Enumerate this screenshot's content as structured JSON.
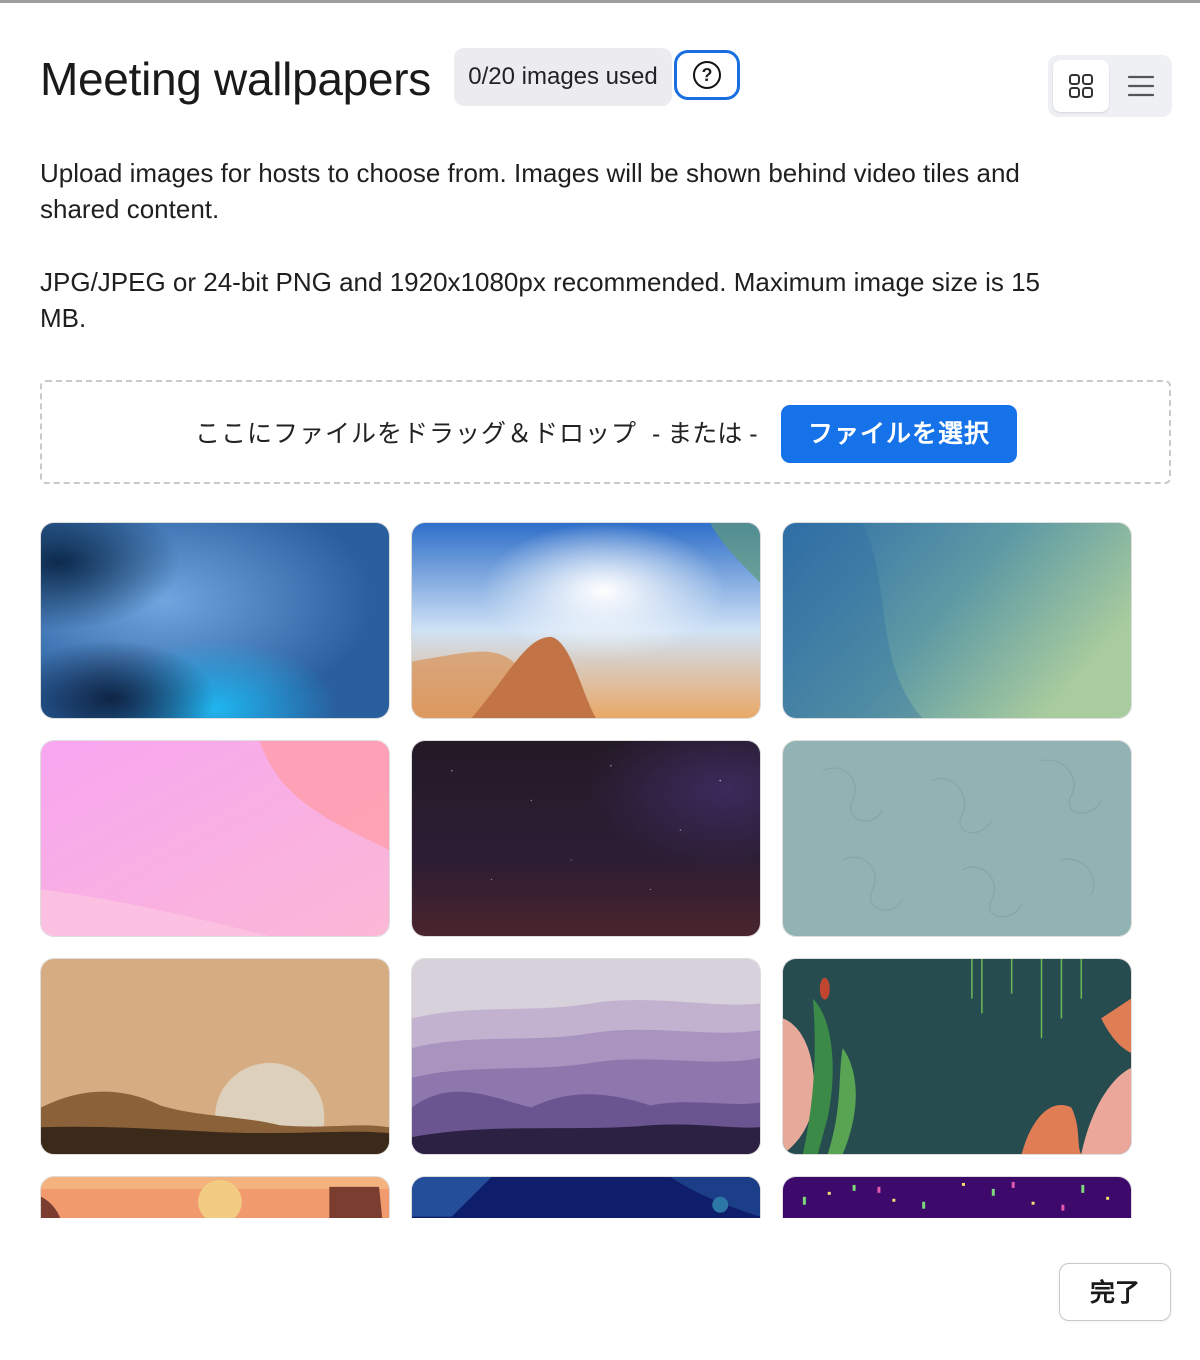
{
  "header": {
    "title": "Meeting wallpapers",
    "usage_badge": "0/20 images used",
    "help_symbol": "?",
    "view_modes": [
      "grid-view-icon",
      "list-view-icon"
    ],
    "active_view": "grid"
  },
  "description": {
    "line1": "Upload images for hosts to choose from. Images will be shown behind video tiles and shared content.",
    "line2": "JPG/JPEG or 24-bit PNG and 1920x1080px recommended. Maximum image size is 15 MB."
  },
  "upload": {
    "drop_text": "ここにファイルをドラッグ＆ドロップ",
    "or_text": "- または -",
    "select_button": "ファイルを選択"
  },
  "wallpapers": [
    {
      "name": "blue-abstract"
    },
    {
      "name": "aurora-dune"
    },
    {
      "name": "teal-green-gradient"
    },
    {
      "name": "pink-gradient"
    },
    {
      "name": "night-sky"
    },
    {
      "name": "sage-pattern"
    },
    {
      "name": "desert-sunset"
    },
    {
      "name": "purple-hills"
    },
    {
      "name": "jungle-frame"
    },
    {
      "name": "orange-desert"
    },
    {
      "name": "deep-sea"
    },
    {
      "name": "purple-confetti"
    }
  ],
  "footer": {
    "done_button": "完了"
  },
  "colors": {
    "primary": "#1672e8",
    "focus_ring": "#1a6fe0",
    "badge_bg": "#ececf0"
  }
}
